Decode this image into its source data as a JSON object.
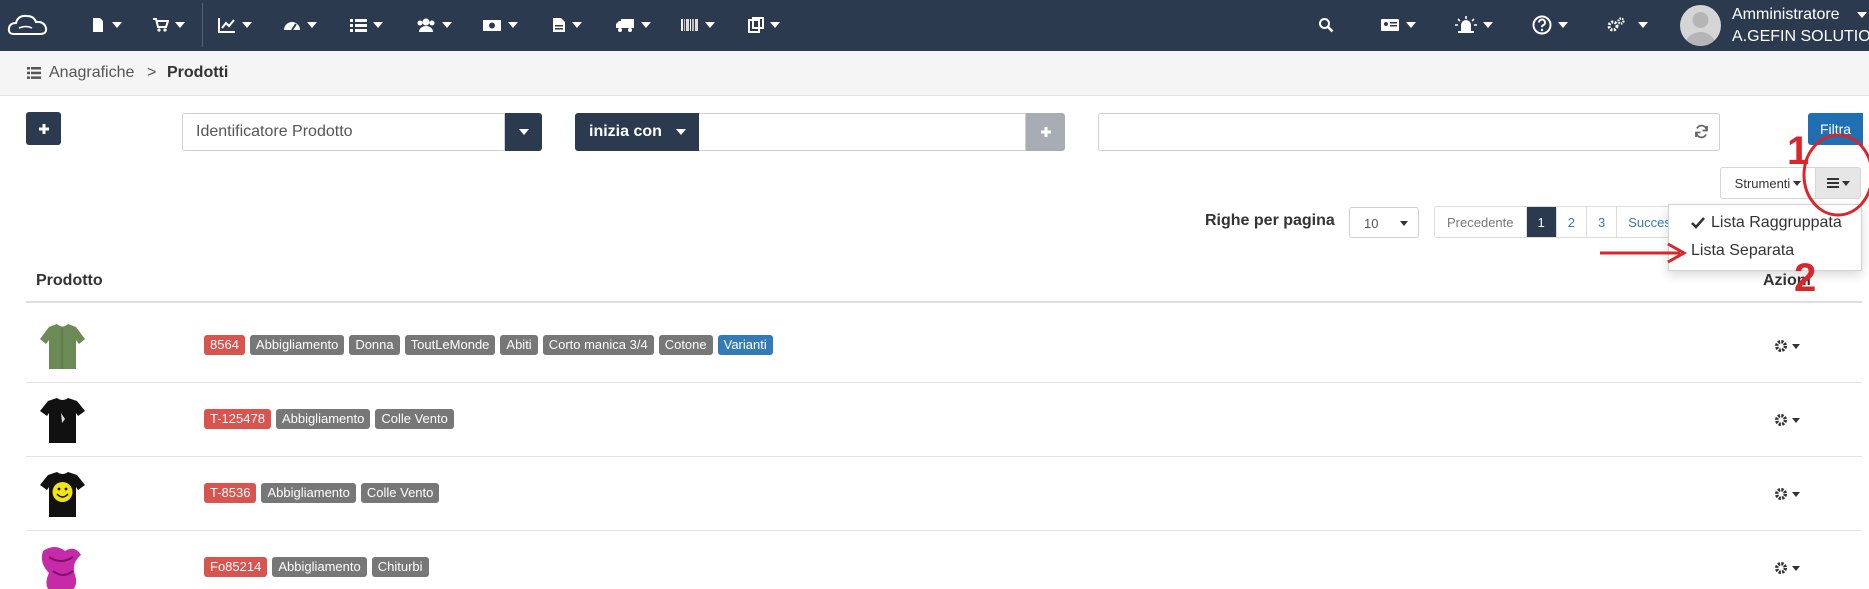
{
  "navbar": {
    "menus": [
      "documents",
      "cart",
      "charts",
      "dashboard",
      "list",
      "users",
      "money",
      "file",
      "truck",
      "barcode",
      "clipboard"
    ],
    "user_name": "Amministratore",
    "user_company": "A.GEFIN SOLUTION",
    "icons": [
      "cloud-logo",
      "search-icon",
      "id-card-icon",
      "alarm-icon",
      "help-icon",
      "cogs-icon"
    ]
  },
  "breadcrumb": {
    "parent": "Anagrafiche",
    "separator": ">",
    "current": "Prodotti"
  },
  "filters": {
    "field_select": "Identificatore Prodotto",
    "operator": "inizia con",
    "value": "",
    "search_value": "",
    "filter_button": "Filtra"
  },
  "tools": {
    "strumenti_label": "Strumenti"
  },
  "pagination": {
    "rows_label": "Righe per pagina",
    "rows_per_page": "10",
    "prev": "Precedente",
    "pages": [
      "1",
      "2",
      "3"
    ],
    "next_partial": "Succes",
    "active_page": "1"
  },
  "dropdown": {
    "item_grouped": "Lista Raggruppata",
    "item_separate": "Lista Separata",
    "checked": "Lista Raggruppata"
  },
  "annotations": {
    "step1": "1",
    "step2": "2",
    "color": "#d9262a"
  },
  "table": {
    "col_product": "Prodotto",
    "col_actions": "Azioni",
    "rows": [
      {
        "code": "8564",
        "tags": [
          "Abbigliamento",
          "Donna",
          "ToutLeMonde",
          "Abiti",
          "Corto manica 3/4",
          "Cotone"
        ],
        "variant_tag": "Varianti",
        "thumb": "green-shirt"
      },
      {
        "code": "T-125478",
        "tags": [
          "Abbigliamento",
          "Colle Vento"
        ],
        "thumb": "black-tshirt"
      },
      {
        "code": "T-8536",
        "tags": [
          "Abbigliamento",
          "Colle Vento"
        ],
        "thumb": "smiley-tshirt"
      },
      {
        "code": "Fo85214",
        "tags": [
          "Abbigliamento",
          "Chiturbi"
        ],
        "thumb": "pink-scarf"
      }
    ]
  },
  "colors": {
    "navbar": "#2c3a4f",
    "primary": "#1f6fb2",
    "code_tag": "#d9534f",
    "gray_tag": "#777777",
    "blue_tag": "#337ab7"
  }
}
